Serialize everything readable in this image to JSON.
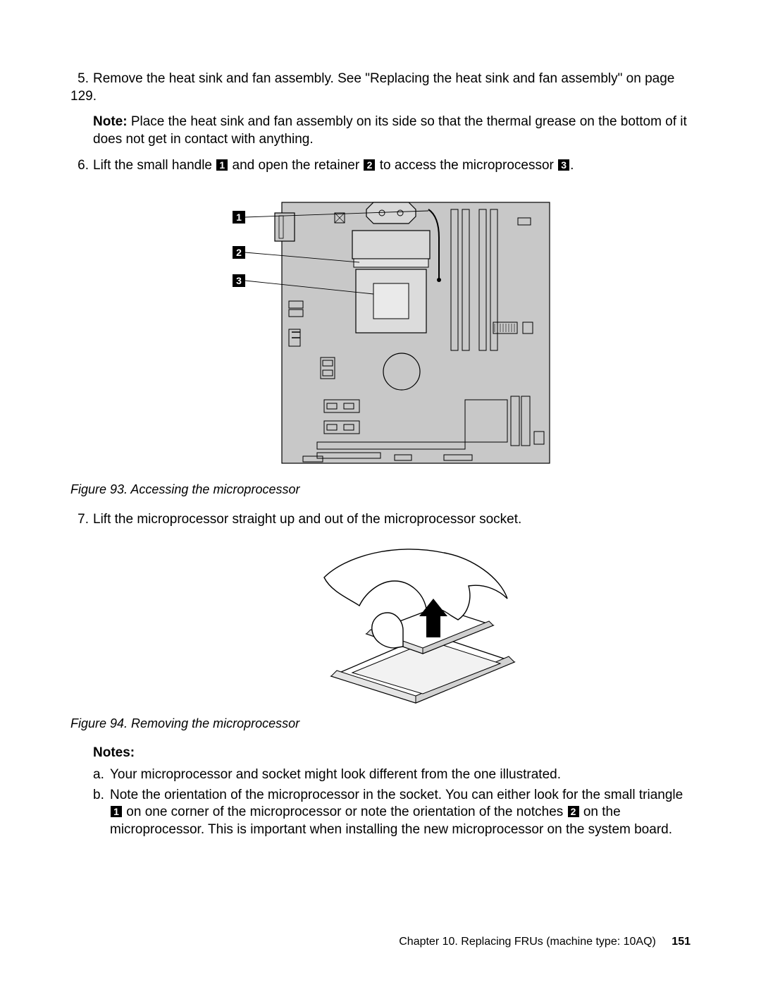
{
  "steps": {
    "s5": {
      "num": "5.",
      "text_a": "Remove the heat sink and fan assembly. See \"Replacing the heat sink and fan assembly\" on page 129.",
      "note_label": "Note:",
      "note_text": " Place the heat sink and fan assembly on its side so that the thermal grease on the bottom of it does not get in contact with anything."
    },
    "s6": {
      "num": "6.",
      "t1": "Lift the small handle ",
      "c1": "1",
      "t2": " and open the retainer ",
      "c2": "2",
      "t3": " to access the microprocessor ",
      "c3": "3",
      "t4": "."
    },
    "s7": {
      "num": "7.",
      "text": "Lift the microprocessor straight up and out of the microprocessor socket."
    }
  },
  "fig93": {
    "caption": "Figure 93.  Accessing the microprocessor",
    "labels": {
      "l1": "1",
      "l2": "2",
      "l3": "3"
    }
  },
  "fig94": {
    "caption": "Figure 94.  Removing the microprocessor"
  },
  "notes": {
    "heading": "Notes:",
    "a": {
      "marker": "a.",
      "text": "Your microprocessor and socket might look different from the one illustrated."
    },
    "b": {
      "marker": "b.",
      "t1": "Note the orientation of the microprocessor in the socket. You can either look for the small triangle ",
      "c1": "1",
      "t2": " on one corner of the microprocessor or note the orientation of the notches ",
      "c2": "2",
      "t3": " on the microprocessor. This is important when installing the new microprocessor on the system board."
    }
  },
  "footer": {
    "chapter": "Chapter 10.  Replacing FRUs (machine type:  10AQ)",
    "page": "151"
  }
}
